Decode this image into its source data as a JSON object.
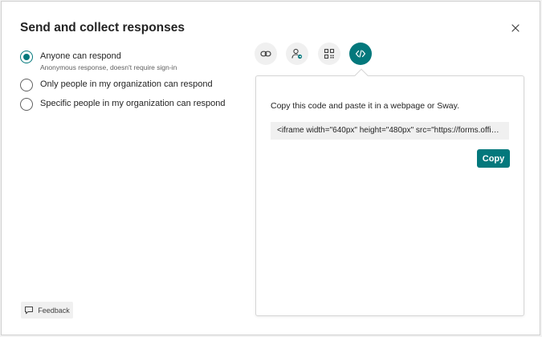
{
  "dialog": {
    "title": "Send and collect responses",
    "close_icon": "close-icon"
  },
  "audience": {
    "options": [
      {
        "label": "Anyone can respond",
        "sublabel": "Anonymous response, doesn't require sign-in",
        "selected": true
      },
      {
        "label": "Only people in my organization can respond",
        "selected": false
      },
      {
        "label": "Specific people in my organization can respond",
        "selected": false
      }
    ]
  },
  "share_methods": {
    "tabs": [
      {
        "icon": "link-icon",
        "active": false
      },
      {
        "icon": "invite-person-icon",
        "active": false
      },
      {
        "icon": "qr-code-icon",
        "active": false
      },
      {
        "icon": "embed-code-icon",
        "active": true
      }
    ]
  },
  "embed": {
    "instructions": "Copy this code and paste it in a webpage or Sway.",
    "code": "<iframe width=\"640px\" height=\"480px\" src=\"https://forms.office...",
    "copy_label": "Copy"
  },
  "feedback": {
    "label": "Feedback",
    "icon": "comment-icon"
  },
  "colors": {
    "accent": "#03787c",
    "tab_background": "#f0f0f0",
    "text": "#242424"
  }
}
